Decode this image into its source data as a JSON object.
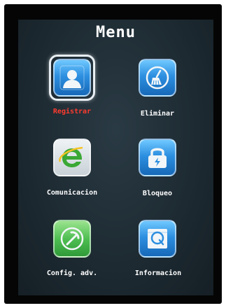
{
  "title": "Menu",
  "items": [
    {
      "label": "Registrar",
      "icon": "register-user-icon",
      "selected": true
    },
    {
      "label": "Eliminar",
      "icon": "delete-broom-icon",
      "selected": false
    },
    {
      "label": "Comunicacion",
      "icon": "communication-e-icon",
      "selected": false
    },
    {
      "label": "Bloqueo",
      "icon": "lock-icon",
      "selected": false
    },
    {
      "label": "Config. adv.",
      "icon": "advanced-config-pickaxe-icon",
      "selected": false
    },
    {
      "label": "Informacion",
      "icon": "information-icon",
      "selected": false
    }
  ],
  "colors": {
    "selected_label": "#ff3b2e",
    "label": "#ffffff",
    "tile_blue": "#2d8fe0",
    "tile_green": "#4fbf52"
  }
}
